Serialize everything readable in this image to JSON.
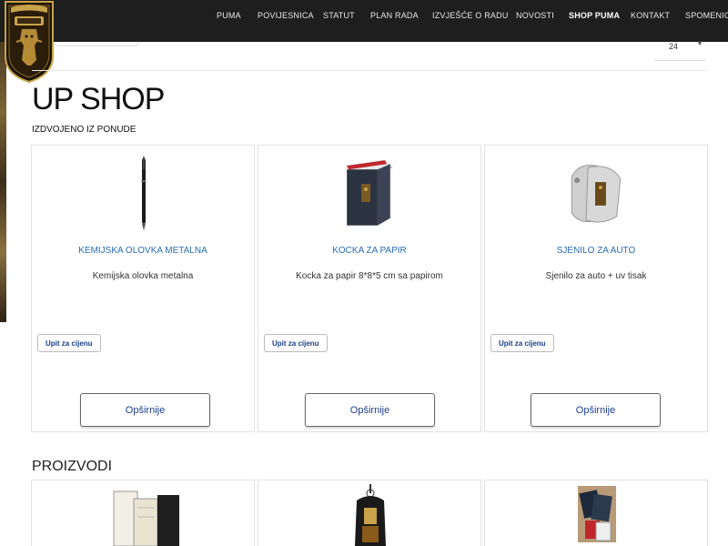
{
  "nav": {
    "items": [
      "PUMA",
      "POVIJESNICA",
      "STATUT",
      "PLAN RADA",
      "IZVJEŠĆE O RADU",
      "NOVOSTI",
      "SHOP PUMA",
      "KONTAKT",
      "SPOMENICI"
    ],
    "active": "SHOP PUMA"
  },
  "per_page": {
    "value": "24"
  },
  "shop": {
    "title": "UP SHOP",
    "featured_label": "IZDVOJENO IZ PONUDE",
    "products_label": "PROIZVODI"
  },
  "featured": [
    {
      "name": "KEMIJSKA OLOVKA METALNA",
      "description": "Kemijska olovka metalna",
      "inquire": "Upit za cijenu",
      "more": "Opširnije",
      "icon": "pen-image"
    },
    {
      "name": "KOCKA ZA PAPIR",
      "description": "Kocka za papir 8*8*5 cm sa papirom",
      "inquire": "Upit za cijenu",
      "more": "Opširnije",
      "icon": "paper-cube-image"
    },
    {
      "name": "SJENILO ZA AUTO",
      "description": "Sjenilo za auto + uv tisak",
      "inquire": "Upit za cijenu",
      "more": "Opširnije",
      "icon": "car-sunshade-image"
    }
  ],
  "products": [
    {
      "icon": "notebooks-image"
    },
    {
      "icon": "air-freshener-image"
    },
    {
      "icon": "playing-cards-image"
    }
  ],
  "colors": {
    "nav_bg": "#1e1e1e",
    "link": "#2a6db3",
    "button_text": "#1b3f8a"
  }
}
